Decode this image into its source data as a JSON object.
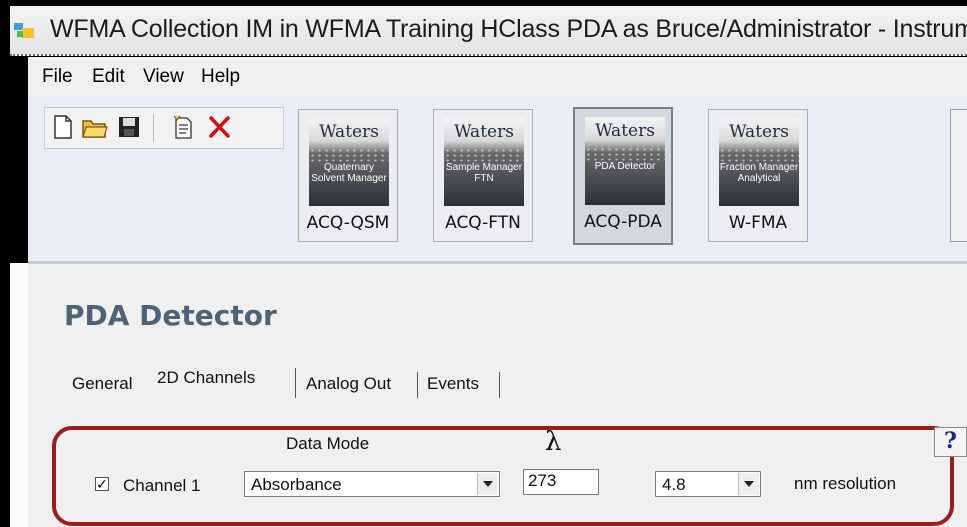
{
  "window": {
    "title": "WFMA Collection IM in WFMA Training HClass PDA as Bruce/Administrator - Instrument"
  },
  "menu": {
    "items": [
      {
        "label": "File"
      },
      {
        "label": "Edit"
      },
      {
        "label": "View"
      },
      {
        "label": "Help"
      }
    ]
  },
  "toolbar": {
    "icons": [
      "new-file-icon",
      "open-folder-icon",
      "save-icon",
      "properties-icon",
      "delete-icon"
    ],
    "delete_color": "#d01010"
  },
  "modules": [
    {
      "brand": "Waters",
      "subtitle": "Quaternary Solvent Manager",
      "label": "ACQ-QSM",
      "active": false
    },
    {
      "brand": "Waters",
      "subtitle": "Sample Manager FTN",
      "label": "ACQ-FTN",
      "active": false
    },
    {
      "brand": "Waters",
      "subtitle": "PDA Detector",
      "label": "ACQ-PDA",
      "active": true
    },
    {
      "brand": "Waters",
      "subtitle": "Fraction Manager Analytical",
      "label": "W-FMA",
      "active": false
    }
  ],
  "panel": {
    "title": "PDA Detector",
    "tabs": [
      {
        "label": "General",
        "selected": false
      },
      {
        "label": "2D Channels",
        "selected": true
      },
      {
        "label": "Analog Out",
        "selected": false
      },
      {
        "label": "Events",
        "selected": false
      }
    ],
    "data_mode_header": "Data Mode",
    "lambda_header": "λ",
    "help_label": "?",
    "channel": {
      "label": "Channel 1",
      "checked": true,
      "check_mark": "✓",
      "data_mode": "Absorbance",
      "wavelength": "273",
      "resolution": "4.8",
      "resolution_unit": "nm resolution"
    },
    "highlight_color": "#9b1d1d"
  }
}
